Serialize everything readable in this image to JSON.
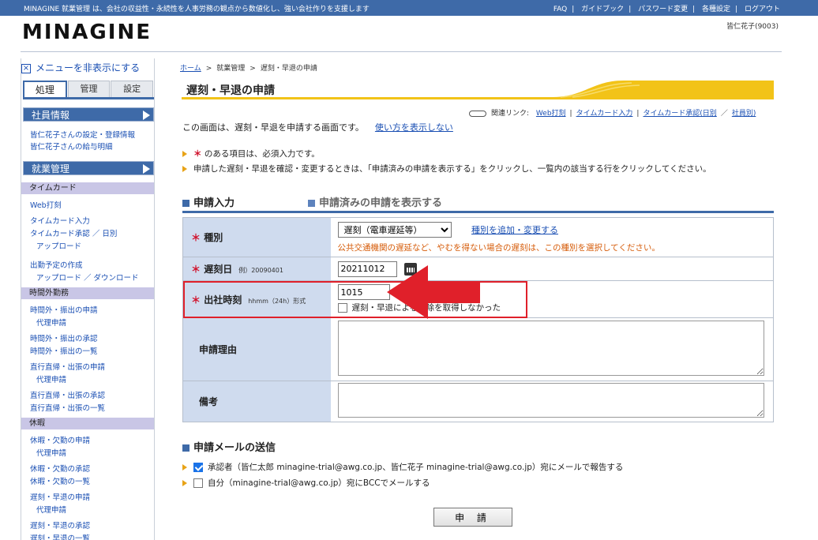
{
  "topbar": {
    "tagline": "MINAGINE 就業管理 は、会社の収益性・永続性を人事労務の観点から数値化し、強い会社作りを支援します",
    "links": [
      "FAQ",
      "ガイドブック",
      "パスワード変更",
      "各種設定",
      "ログアウト"
    ]
  },
  "header": {
    "logo": "MINAGINE",
    "user": "皆仁花子(9003)"
  },
  "sidebar": {
    "toggle": "メニューを非表示にする",
    "tabs": [
      "処理",
      "管理",
      "設定"
    ],
    "sections": {
      "employee": "社員情報",
      "employee_links": [
        "皆仁花子さんの設定・登録情報",
        "皆仁花子さんの給与明細"
      ],
      "work": "就業管理"
    },
    "timecard": {
      "title": "タイムカード",
      "links": [
        "Web打刻",
        "タイムカード入力",
        "タイムカード承認 ／ 日別",
        "アップロード",
        "出勤予定の作成",
        "アップロード ／ ダウンロード"
      ]
    },
    "overtime": {
      "title": "時間外勤務",
      "links": [
        "時間外・振出の申請",
        "代理申請",
        "時間外・振出の承認",
        "時間外・振出の一覧",
        "直行直帰・出張の申請",
        "代理申請",
        "直行直帰・出張の承認",
        "直行直帰・出張の一覧"
      ]
    },
    "leave": {
      "title": "休暇",
      "links": [
        "休暇・欠勤の申請",
        "代理申請",
        "休暇・欠勤の承認",
        "休暇・欠勤の一覧",
        "遅刻・早退の申請",
        "代理申請",
        "遅刻・早退の承認",
        "遅刻・早退の一覧"
      ]
    }
  },
  "breadcrumb": {
    "home": "ホーム",
    "sep": ">",
    "mid": "就業管理",
    "current": "遅刻・早退の申請"
  },
  "page_title": "遅刻・早退の申請",
  "related": {
    "label": "関連リンク:",
    "links": [
      "Web打刻",
      "タイムカード入力",
      "タイムカード承認(日別",
      "社員別)"
    ]
  },
  "intro": {
    "text": "この画面は、遅刻・早退を申請する画面です。",
    "link": "使い方を表示しない"
  },
  "notes": {
    "required_mark": "＊",
    "required_text": "のある項目は、必須入力です。",
    "confirm_text": "申請した遅刻・早退を確認・変更するときは、「申請済みの申請を表示する」をクリックし、一覧内の該当する行をクリックしてください。"
  },
  "section_input": "申請入力",
  "section_applied": "申請済みの申請を表示する",
  "form": {
    "type": {
      "label": "種別",
      "selected": "遅刻（電車遅延等）",
      "add_link": "種別を追加・変更する",
      "hint": "公共交通機関の遅延など、やむを得ない場合の遅刻は、この種別を選択してください。"
    },
    "date": {
      "label": "遅刻日",
      "example": "例）20090401",
      "value": "20211012"
    },
    "time": {
      "label": "出社時刻",
      "format": "hhmm（24h）形式",
      "value": "1015",
      "checkbox_label": "遅刻・早退による控除を取得しなかった"
    },
    "reason": {
      "label": "申請理由",
      "value": ""
    },
    "remarks": {
      "label": "備考",
      "value": ""
    }
  },
  "mail": {
    "title": "申請メールの送信",
    "approver": "承認者（皆仁太郎 minagine-trial@awg.co.jp、皆仁花子 minagine-trial@awg.co.jp）宛にメールで報告する",
    "self": "自分（minagine-trial@awg.co.jp）宛にBCCでメールする"
  },
  "submit_label": "申 請",
  "colors": {
    "brand": "#3e6aa8",
    "accent": "#f2c318",
    "required": "#d0112b",
    "highlight": "#e0202a"
  }
}
